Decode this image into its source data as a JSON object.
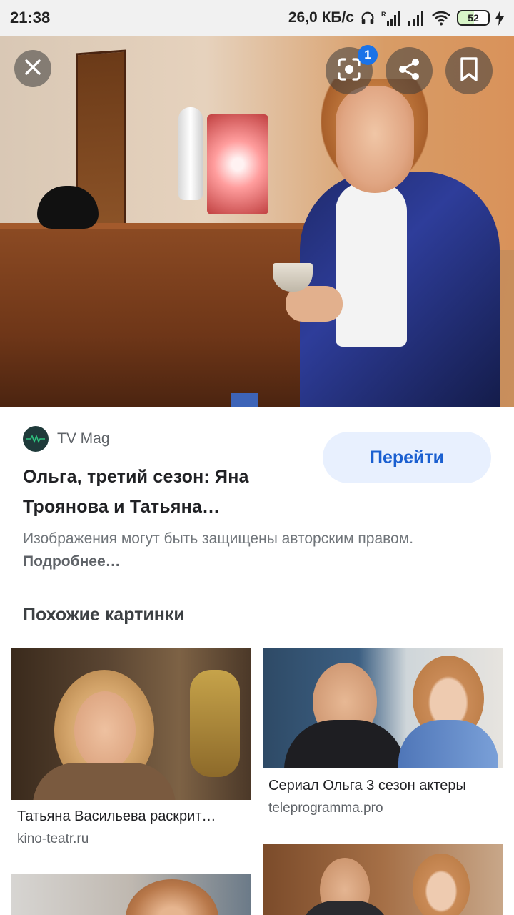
{
  "status_bar": {
    "time": "21:38",
    "network_speed": "26,0 КБ/с",
    "battery_level": "52"
  },
  "hero": {
    "lens_badge_count": "1",
    "icons": [
      "close-icon",
      "lens-icon",
      "share-icon",
      "bookmark-icon"
    ]
  },
  "source": {
    "name": "TV Mag",
    "title": "Ольга, третий сезон: Яна Троянова и Татьяна…",
    "visit_label": "Перейти",
    "copyright_text": "Изображения могут быть защищены авторским правом.",
    "more_label": "Подробнее…"
  },
  "similar": {
    "heading": "Похожие картинки",
    "items": [
      {
        "title": "Татьяна Васильева раскрит…",
        "source": "kino-teatr.ru"
      },
      {
        "title": "Сериал Ольга 3 сезон актеры",
        "source": "teleprogramma.pro"
      }
    ]
  },
  "colors": {
    "accent": "#1a73e8",
    "visit_button_bg": "#e8f0fe",
    "visit_button_text": "#1a5fd0"
  }
}
